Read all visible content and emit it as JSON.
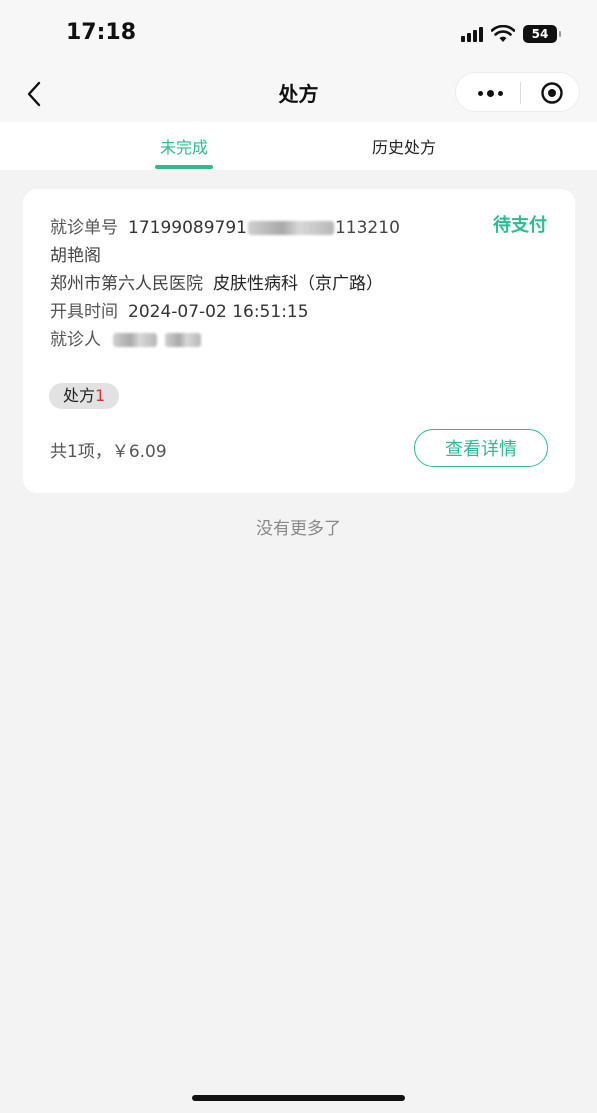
{
  "status_bar": {
    "time": "17:18",
    "battery": "54"
  },
  "nav": {
    "title": "处方"
  },
  "tabs": {
    "active": "未完成",
    "history": "历史处方"
  },
  "card": {
    "number_label": "就诊单号",
    "number_prefix": "17199089791",
    "number_suffix": "113210",
    "status": "待支付",
    "name": "胡艳阁",
    "hospital": "郑州市第六人民医院",
    "department": "皮肤性病科（京广路）",
    "time_label": "开具时间",
    "time_value": "2024-07-02 16:51:15",
    "patient_label": "就诊人",
    "rx_tag": "处方",
    "rx_count": "1",
    "summary": "共1项，￥6.09",
    "detail_button": "查看详情"
  },
  "footer": {
    "no_more": "没有更多了"
  },
  "colors": {
    "accent": "#2bbd8f",
    "badge_red": "#e03131",
    "background": "#f3f3f3"
  }
}
